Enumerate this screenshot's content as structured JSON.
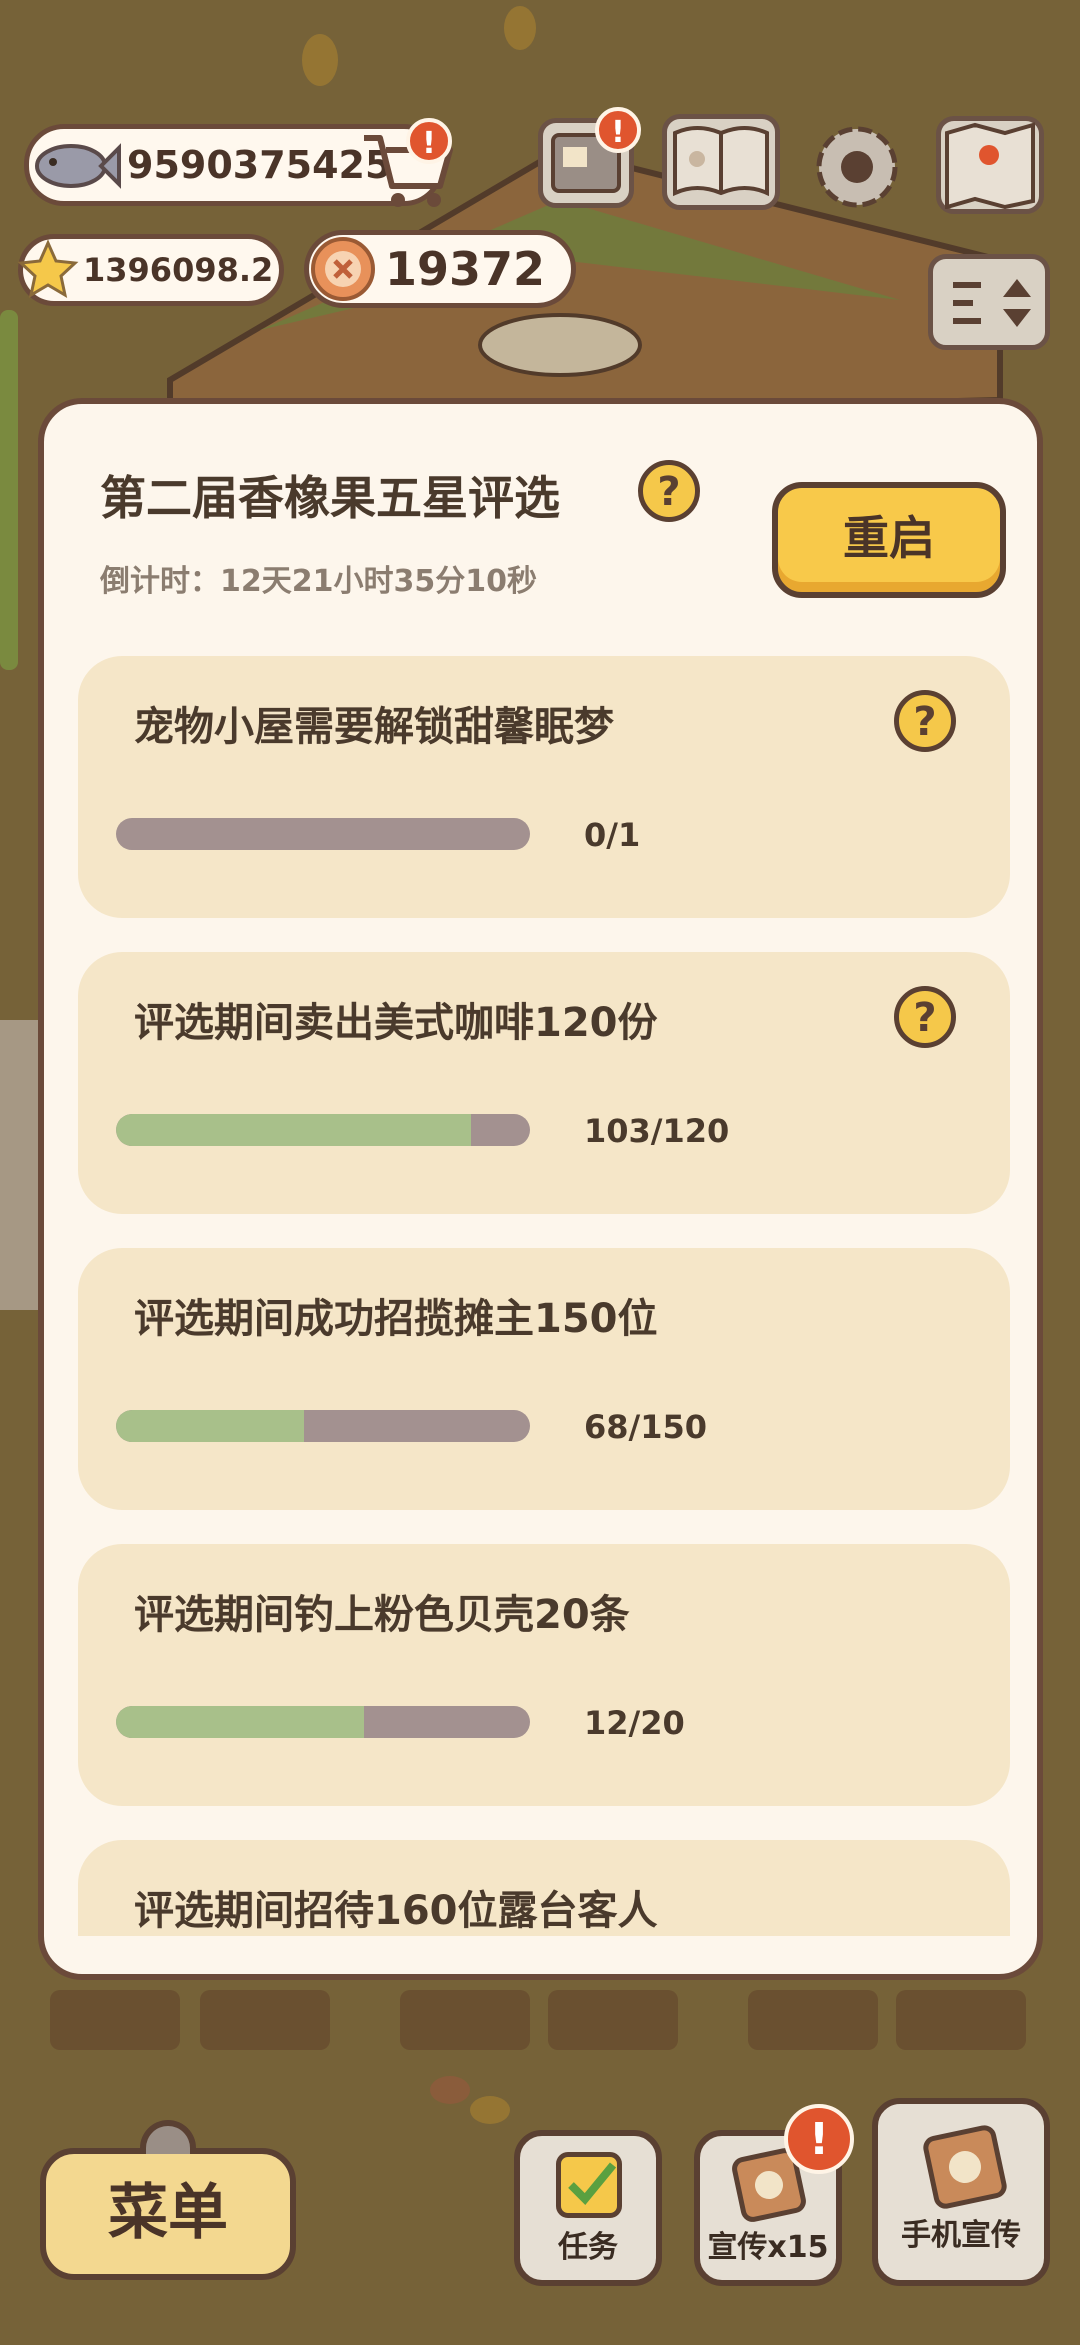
{
  "hud": {
    "fish_value": "9590375425",
    "star_value": "1396098.2",
    "coin_value": "19372",
    "cart_badge": "!",
    "mail_badge": "!"
  },
  "dialog": {
    "title": "第二届香橡果五星评选",
    "countdown": "倒计时：12天21小时35分10秒",
    "restart_label": "重启",
    "help_glyph": "?",
    "tasks": [
      {
        "label": "宠物小屋需要解锁甜馨眠梦",
        "count": "0/1",
        "progress": 0,
        "has_help": true
      },
      {
        "label": "评选期间卖出美式咖啡120份",
        "count": "103/120",
        "progress": 0.858,
        "has_help": true
      },
      {
        "label": "评选期间成功招揽摊主150位",
        "count": "68/150",
        "progress": 0.453,
        "has_help": false
      },
      {
        "label": "评选期间钓上粉色贝壳20条",
        "count": "12/20",
        "progress": 0.6,
        "has_help": false
      },
      {
        "label": "评选期间招待160位露台客人",
        "count": "",
        "progress": 0,
        "has_help": false
      }
    ]
  },
  "bottom": {
    "menu_label": "菜单",
    "tasks_label": "任务",
    "promo_label": "宣传x15",
    "promo_badge": "!",
    "phone_promo_label": "手机宣传"
  },
  "colors": {
    "progress_fill": "#a8c08a",
    "progress_track": "#a39190",
    "card_bg": "#f5e6c8",
    "restart_bg": "#f8c94a",
    "badge_red": "#e0552e"
  }
}
